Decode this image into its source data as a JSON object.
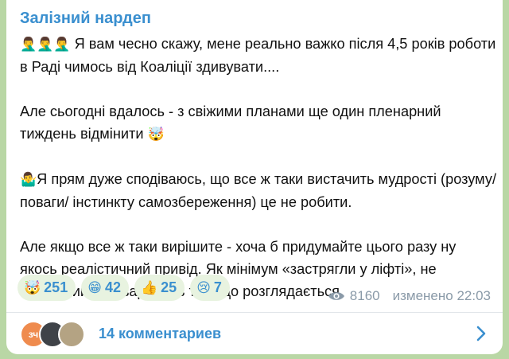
{
  "channel": {
    "name": "Залізний нардеп"
  },
  "message": {
    "paragraphs": [
      {
        "emoji": "🤦‍♂️🤦‍♂️🤦‍♂️",
        "text": " Я вам чесно скажу, мене реально важко після 4,5 років роботи в Раді чимось від Коаліції здивувати...."
      },
      {
        "text": "Але сьогодні вдалось - з свіжими планами ще один пленарний тиждень відмінити ",
        "emoji_after": "🤯"
      },
      {
        "emoji": "🤷‍♂️",
        "text": "Я прям дуже сподіваюсь, що все ж таки вистачить мудрості (розуму/ поваги/ інстинкту самозбереження) це не робити."
      },
      {
        "text": "Але якщо все ж таки вирішите - хоча б придумайте цього разу ну якось реалістичний привід. Як мінімум «застрягли у ліфті», не найгірший вже варіант із тих, що розглядається."
      }
    ]
  },
  "reactions": [
    {
      "emoji": "🤯",
      "count": "251"
    },
    {
      "emoji": "😁",
      "count": "42"
    },
    {
      "emoji": "👍",
      "count": "25"
    },
    {
      "emoji": "😢",
      "count": "7"
    }
  ],
  "meta": {
    "views": "8160",
    "edited": "изменено 22:03"
  },
  "comments": {
    "avatar_initials": "зч",
    "label": "14 комментариев"
  },
  "colors": {
    "accent": "#3a8fcf",
    "background": "#b9d7a5",
    "reaction_bg": "#e8f3e0",
    "muted": "#8a9aa8"
  },
  "icons": {
    "views": "eye-icon",
    "open_comments": "chevron-right-icon"
  }
}
